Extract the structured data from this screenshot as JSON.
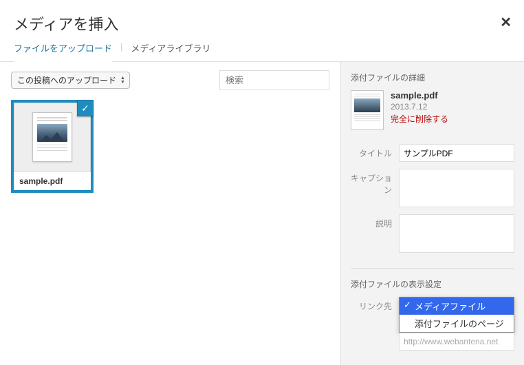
{
  "header": {
    "title": "メディアを挿入"
  },
  "tabs": {
    "upload": "ファイルをアップロード",
    "library": "メディアライブラリ"
  },
  "toolbar": {
    "filter_label": "この投稿へのアップロード",
    "search_placeholder": "検索"
  },
  "library": {
    "items": [
      {
        "filename": "sample.pdf"
      }
    ]
  },
  "sidebar": {
    "details_title": "添付ファイルの詳細",
    "file": {
      "name": "sample.pdf",
      "date": "2013.7.12",
      "delete": "完全に削除する"
    },
    "labels": {
      "title": "タイトル",
      "caption": "キャプション",
      "description": "説明"
    },
    "values": {
      "title": "サンプルPDF",
      "caption": "",
      "description": ""
    },
    "display_title": "添付ファイルの表示設定",
    "link_label": "リンク先",
    "link_options": {
      "media": "メディアファイル",
      "page": "添付ファイルのページ"
    },
    "url": "http://www.webantena.net"
  }
}
